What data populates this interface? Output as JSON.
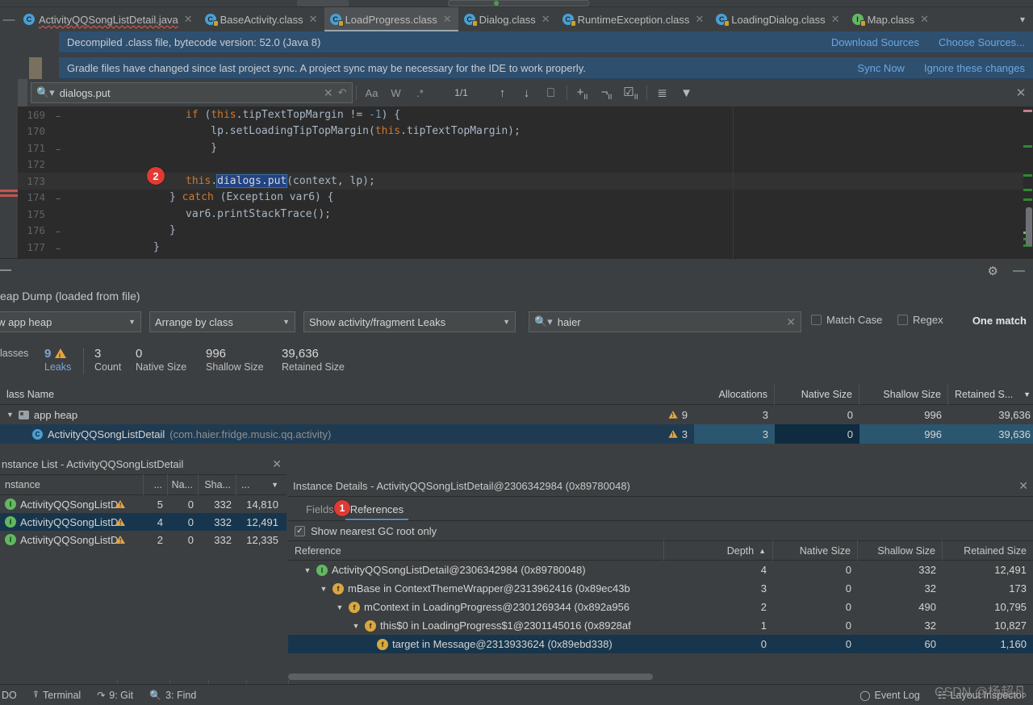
{
  "window": {
    "collapse_icon": "collapse-all"
  },
  "tabs": [
    {
      "label": "ActivityQQSongListDetail.java",
      "icon": "java-class-icon",
      "active": false,
      "warn": true,
      "locked": false,
      "kind": "c"
    },
    {
      "label": "BaseActivity.class",
      "icon": "java-class-locked-icon",
      "active": false,
      "warn": false,
      "locked": true,
      "kind": "c"
    },
    {
      "label": "LoadProgress.class",
      "icon": "java-class-locked-icon",
      "active": true,
      "warn": false,
      "locked": true,
      "kind": "c"
    },
    {
      "label": "Dialog.class",
      "icon": "java-class-locked-icon",
      "active": false,
      "warn": false,
      "locked": true,
      "kind": "c"
    },
    {
      "label": "RuntimeException.class",
      "icon": "java-class-locked-icon",
      "active": false,
      "warn": false,
      "locked": true,
      "kind": "c"
    },
    {
      "label": "LoadingDialog.class",
      "icon": "java-class-locked-icon",
      "active": false,
      "warn": false,
      "locked": true,
      "kind": "c"
    },
    {
      "label": "Map.class",
      "icon": "java-interface-locked-icon",
      "active": false,
      "warn": false,
      "locked": true,
      "kind": "i"
    }
  ],
  "banners": [
    {
      "text": "Decompiled .class file, bytecode version: 52.0 (Java 8)",
      "actions": [
        "Download Sources",
        "Choose Sources..."
      ]
    },
    {
      "text": "Gradle files have changed since last project sync. A project sync may be necessary for the IDE to work properly.",
      "actions": [
        "Sync Now",
        "Ignore these changes"
      ]
    }
  ],
  "find": {
    "query": "dialogs.put",
    "count": "1/1",
    "options": [
      "Aa",
      "W",
      ".*"
    ],
    "buttons": [
      "prev-match",
      "next-match",
      "select-all-occurrences",
      "add-line-before",
      "remove-line",
      "toggle-line",
      "sort-lines",
      "filter"
    ]
  },
  "editor": {
    "lines": [
      {
        "num": "169",
        "fold": "⊖",
        "indent": 0,
        "html": "<span class='kw'>if</span> (<span class='kw'>this</span>.tipTextTopMargin != <span class='num'>-1</span>) {"
      },
      {
        "num": "170",
        "fold": "",
        "indent": 0,
        "html": "    lp.setLoadingTipTopMargin(<span class='kw'>this</span>.tipTextTopMargin);"
      },
      {
        "num": "171",
        "fold": "⊖",
        "indent": 0,
        "html": "}"
      },
      {
        "num": "172",
        "fold": "",
        "indent": 0,
        "html": ""
      },
      {
        "num": "173",
        "fold": "",
        "indent": 0,
        "html": "<span class='kw'>this</span>.<span class='sel'>dialogs.put</span>(context, lp);"
      },
      {
        "num": "174",
        "fold": "⊖",
        "indent": 0,
        "html": "} <span class='kw'>catch</span> (Exception var6) {"
      },
      {
        "num": "175",
        "fold": "",
        "indent": 0,
        "html": "    var6.printStackTrace();"
      },
      {
        "num": "176",
        "fold": "⊖",
        "indent": 0,
        "html": "}"
      },
      {
        "num": "177",
        "fold": "⊖",
        "indent": 0,
        "html": "}"
      }
    ],
    "annotation_badge": "2"
  },
  "profiler": {
    "panel_icons": [
      "settings-gear",
      "minimize"
    ],
    "heap_title": "eap Dump (loaded from file)",
    "filters": [
      {
        "name": "heap-selector",
        "value": "iew app heap"
      },
      {
        "name": "arrange-selector",
        "value": "Arrange by class"
      },
      {
        "name": "leak-filter-selector",
        "value": "Show activity/fragment Leaks"
      }
    ],
    "search": {
      "value": "haier",
      "match_case": "Match Case",
      "regex": "Regex",
      "result": "One match"
    },
    "stats": [
      {
        "value": "",
        "label": "lasses"
      },
      {
        "value": "9",
        "label": "Leaks",
        "highlight": true,
        "warning": true
      },
      {
        "value": "3",
        "label": "Count"
      },
      {
        "value": "0",
        "label": "Native Size"
      },
      {
        "value": "996",
        "label": "Shallow Size"
      },
      {
        "value": "39,636",
        "label": "Retained Size"
      }
    ]
  },
  "class_table": {
    "columns": [
      "lass Name",
      "Allocations",
      "Native Size",
      "Shallow Size",
      "Retained S..."
    ],
    "sort_column": "Retained S...",
    "rows": [
      {
        "name": "app heap",
        "pkg": "",
        "icon": "folder-icon",
        "expanded": true,
        "depth": 0,
        "warn": "9",
        "allocations": "3",
        "native": "0",
        "shallow": "996",
        "retained": "39,636",
        "selected": false
      },
      {
        "name": "ActivityQQSongListDetail",
        "pkg": "(com.haier.fridge.music.qq.activity)",
        "icon": "class-icon",
        "expanded": false,
        "depth": 1,
        "warn": "3",
        "allocations": "3",
        "native": "0",
        "shallow": "996",
        "retained": "39,636",
        "selected": true
      }
    ]
  },
  "instance_list": {
    "title": "nstance List - ActivityQQSongListDetail",
    "columns": [
      "nstance",
      "...",
      "Na...",
      "Sha...",
      "..."
    ],
    "rows": [
      {
        "name": "ActivityQQSongListD",
        "icon": "instance-icon",
        "warn": true,
        "depth": "5",
        "native": "0",
        "shallow": "332",
        "retained": "14,810",
        "selected": false
      },
      {
        "name": "ActivityQQSongListD",
        "icon": "instance-icon",
        "warn": true,
        "depth": "4",
        "native": "0",
        "shallow": "332",
        "retained": "12,491",
        "selected": true
      },
      {
        "name": "ActivityQQSongListD",
        "icon": "instance-icon",
        "warn": true,
        "depth": "2",
        "native": "0",
        "shallow": "332",
        "retained": "12,335",
        "selected": false
      }
    ]
  },
  "instance_details": {
    "title": "Instance Details - ActivityQQSongListDetail@2306342984 (0x89780048)",
    "tabs": [
      {
        "label": "Fields",
        "active": false
      },
      {
        "label": "References",
        "active": true
      }
    ],
    "annotation_badge": "1",
    "gc_checkbox": {
      "label": "Show nearest GC root only",
      "checked": true
    },
    "columns": [
      "Reference",
      "Depth",
      "Native Size",
      "Shallow Size",
      "Retained Size"
    ],
    "sort_column": "Depth",
    "rows": [
      {
        "ref": "ActivityQQSongListDetail@2306342984 (0x89780048)",
        "icon": "instance-icon",
        "indent": 0,
        "expanded": true,
        "depth": "4",
        "native": "0",
        "shallow": "332",
        "retained": "12,491",
        "selected": false
      },
      {
        "ref": "mBase in ContextThemeWrapper@2313962416 (0x89ec43b",
        "icon": "field-icon",
        "indent": 1,
        "expanded": true,
        "depth": "3",
        "native": "0",
        "shallow": "32",
        "retained": "173",
        "selected": false
      },
      {
        "ref": "mContext in LoadingProgress@2301269344 (0x892a956",
        "icon": "field-icon",
        "indent": 2,
        "expanded": true,
        "depth": "2",
        "native": "0",
        "shallow": "490",
        "retained": "10,795",
        "selected": false
      },
      {
        "ref": "this$0 in LoadingProgress$1@2301145016 (0x8928af",
        "icon": "field-icon",
        "indent": 3,
        "expanded": true,
        "depth": "1",
        "native": "0",
        "shallow": "32",
        "retained": "10,827",
        "selected": false
      },
      {
        "ref": "target in Message@2313933624 (0x89ebd338)",
        "icon": "field-icon",
        "indent": 4,
        "expanded": false,
        "depth": "0",
        "native": "0",
        "shallow": "60",
        "retained": "1,160",
        "selected": true
      }
    ]
  },
  "status_bar": {
    "left": [
      {
        "label": "DO",
        "icon": ""
      },
      {
        "label": "Terminal",
        "icon": "terminal-icon"
      },
      {
        "label": "9: Git",
        "icon": "git-icon"
      },
      {
        "label": "3: Find",
        "icon": "find-icon"
      }
    ],
    "right": [
      {
        "label": "Event Log",
        "icon": "event-log-icon"
      },
      {
        "label": "Layout Inspector",
        "icon": "layout-inspector-icon"
      }
    ],
    "watermark": "CSDN @杨超凡"
  },
  "colors": {
    "accent_blue": "#6aa8e0",
    "banner_bg": "#2f4f6f",
    "selection": "#17364d",
    "warning": "#e8a33d",
    "badge_red": "#e03a33",
    "editor_bg": "#2b2b2b",
    "panel_bg": "#3c3f41"
  }
}
